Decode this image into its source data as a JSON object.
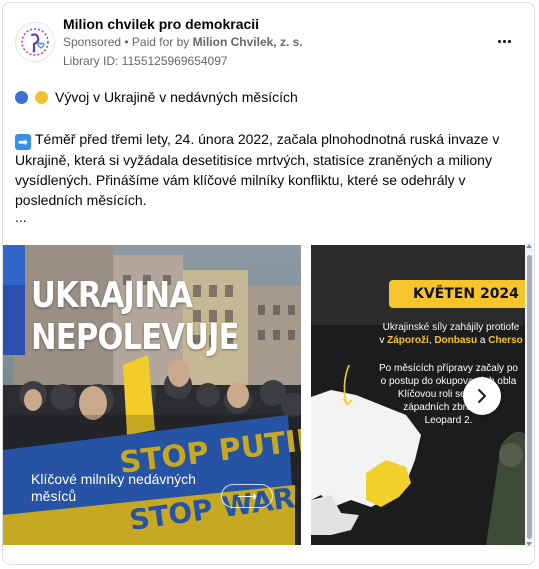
{
  "post": {
    "page_name": "Milion chvilek pro demokracii",
    "sponsored": "Sponsored",
    "paid_prefix": " • Paid for by ",
    "payer": "Milion Chvilek, z. s.",
    "library_id": "Library ID: 1155125969654097",
    "headline": "Vývoj v Ukrajině v nedávných měsících",
    "body": "Téměř před třemi lety, 24. února 2022, začala plnohodnotná ruská invaze v Ukrajině, která si vyžádala desetitisíce mrtvých, statisíce zraněných a miliony vysídlených. Přinášíme vám klíčové milníky konfliktu, které se odehrály v posledních měsících.",
    "more": "..."
  },
  "slides": [
    {
      "title_line1": "UKRAJINA",
      "title_line2": "NEPOLEVUJE",
      "banner_text1": "STOP PUTIN",
      "banner_text2": "STOP WAR",
      "caption": "Klíčové milníky nedávných měsíců",
      "arrow": "⟶"
    },
    {
      "month": "KVĚTEN 2024",
      "p1_line1": "Ukrajinské síly zahájily protiofe",
      "p1_prefix": "v ",
      "region1": "Záporoží",
      "sep1": ", ",
      "region2": "Donbasu",
      "sep2": " a ",
      "region3": "Cherso",
      "p2_line1": "Po měsících přípravy začaly po",
      "p2_line2": "o postup do okupovaných obla",
      "p2_line3": "Klíčovou roli seh         omne",
      "p2_line4": "západních zbraní,          ta",
      "p2_line5": "Leopard 2."
    }
  ],
  "colors": {
    "accent_yellow": "#f7c52b",
    "ukraine_blue": "#2f66c7",
    "ukraine_yellow": "#f2cd2a"
  },
  "icons": {
    "more": "more-horizontal-icon",
    "next": "chevron-right-icon",
    "headline_dot_blue": "blue-circle-emoji",
    "headline_dot_yellow": "yellow-circle-emoji",
    "body_arrow": "right-arrow-emoji"
  }
}
